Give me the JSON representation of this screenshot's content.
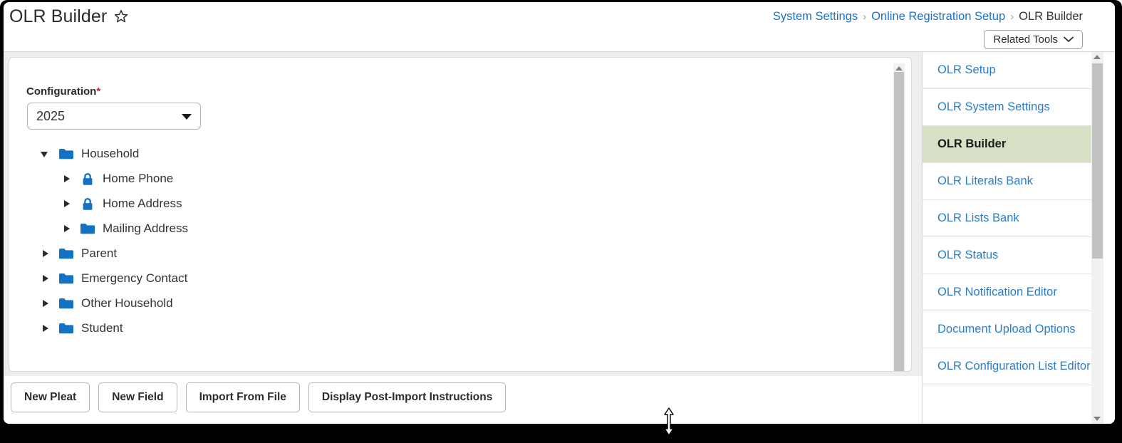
{
  "header": {
    "title": "OLR Builder",
    "favorite_icon": "star-outline-icon",
    "breadcrumb": [
      {
        "label": "System Settings",
        "type": "link"
      },
      {
        "label": "Online Registration Setup",
        "type": "link"
      },
      {
        "label": "OLR Builder",
        "type": "current"
      }
    ],
    "breadcrumb_separator": "›",
    "related_tools_label": "Related Tools"
  },
  "main": {
    "config": {
      "label": "Configuration",
      "required_marker": "*",
      "value": "2025"
    },
    "tree": [
      {
        "label": "Household",
        "depth": 0,
        "state": "expanded",
        "icon": "folder-icon"
      },
      {
        "label": "Home Phone",
        "depth": 1,
        "state": "collapsed",
        "icon": "lock-icon"
      },
      {
        "label": "Home Address",
        "depth": 1,
        "state": "collapsed",
        "icon": "lock-icon"
      },
      {
        "label": "Mailing Address",
        "depth": 1,
        "state": "collapsed",
        "icon": "folder-icon"
      },
      {
        "label": "Parent",
        "depth": 0,
        "state": "collapsed",
        "icon": "folder-icon"
      },
      {
        "label": "Emergency Contact",
        "depth": 0,
        "state": "collapsed",
        "icon": "folder-icon"
      },
      {
        "label": "Other Household",
        "depth": 0,
        "state": "collapsed",
        "icon": "folder-icon"
      },
      {
        "label": "Student",
        "depth": 0,
        "state": "collapsed",
        "icon": "folder-icon"
      }
    ],
    "buttons": [
      {
        "label": "New Pleat"
      },
      {
        "label": "New Field"
      },
      {
        "label": "Import From File"
      },
      {
        "label": "Display Post-Import Instructions"
      }
    ]
  },
  "sidebar": {
    "items": [
      {
        "label": "OLR Setup",
        "active": false
      },
      {
        "label": "OLR System Settings",
        "active": false
      },
      {
        "label": "OLR Builder",
        "active": true
      },
      {
        "label": "OLR Literals Bank",
        "active": false
      },
      {
        "label": "OLR Lists Bank",
        "active": false
      },
      {
        "label": "OLR Status",
        "active": false
      },
      {
        "label": "OLR Notification Editor",
        "active": false
      },
      {
        "label": "Document Upload Options",
        "active": false
      },
      {
        "label": "OLR Configuration List Editor",
        "active": false
      }
    ]
  },
  "colors": {
    "link": "#2e7dc4",
    "active_highlight": "#d7e1c5",
    "folder": "#1472c4",
    "required": "#cc2233",
    "scrollbar_thumb": "#c2c2c2",
    "scrollbar_track": "#f1f1f1"
  },
  "cursor": {
    "type": "vertical-resize-cursor"
  }
}
